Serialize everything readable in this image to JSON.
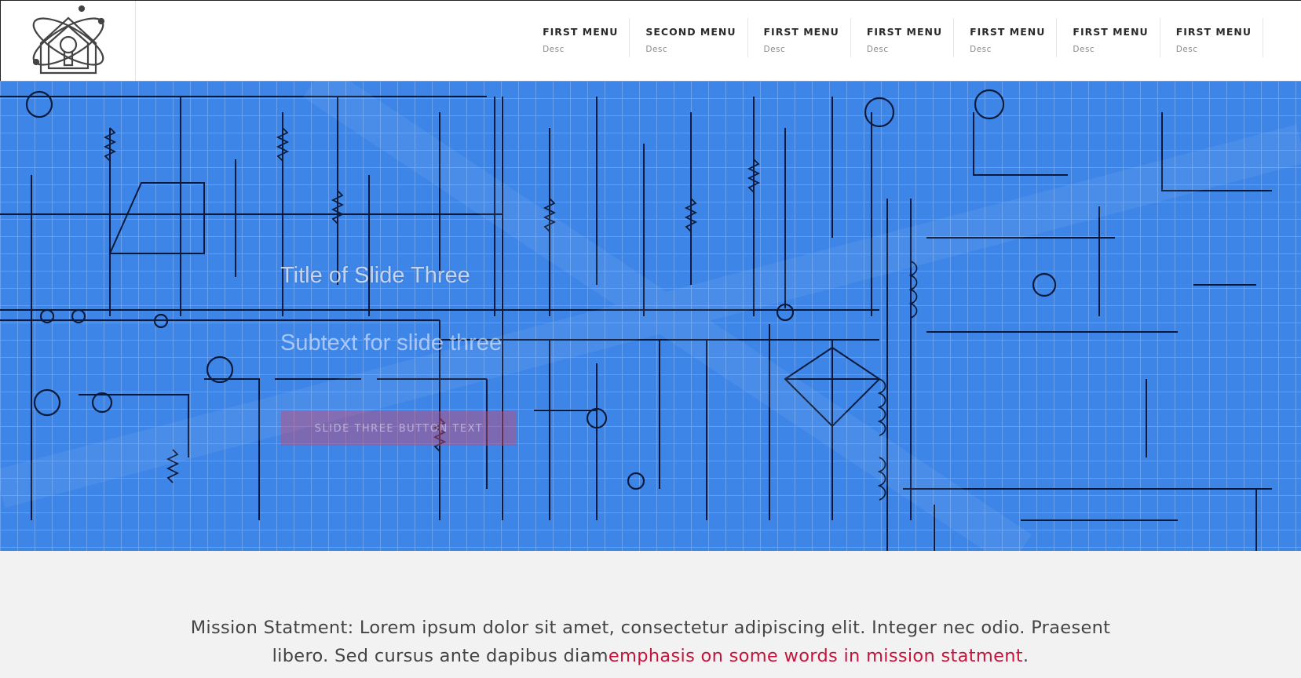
{
  "header": {
    "logo": "atom-house-logo",
    "nav": [
      {
        "label": "FIRST MENU",
        "desc": "Desc"
      },
      {
        "label": "SECOND MENU",
        "desc": "Desc"
      },
      {
        "label": "FIRST MENU",
        "desc": "Desc"
      },
      {
        "label": "FIRST MENU",
        "desc": "Desc"
      },
      {
        "label": "FIRST MENU",
        "desc": "Desc"
      },
      {
        "label": "FIRST MENU",
        "desc": "Desc"
      },
      {
        "label": "FIRST MENU",
        "desc": "Desc"
      }
    ]
  },
  "hero": {
    "title": "Title of Slide Three",
    "subtext": "Subtext for slide three",
    "button_label": "SLIDE THREE BUTTON TEXT",
    "background": "blueprint-schematic",
    "colors": {
      "blueprint": "#3d86e8",
      "button": "#cd466e"
    }
  },
  "mission": {
    "text": "Mission Statment: Lorem ipsum dolor sit amet, consectetur adipiscing elit. Integer nec odio. Praesent libero. Sed cursus ante dapibus diam",
    "emphasis": "emphasis on some words in mission statment",
    "tail": ".",
    "colors": {
      "emphasis": "#c8143c"
    }
  }
}
